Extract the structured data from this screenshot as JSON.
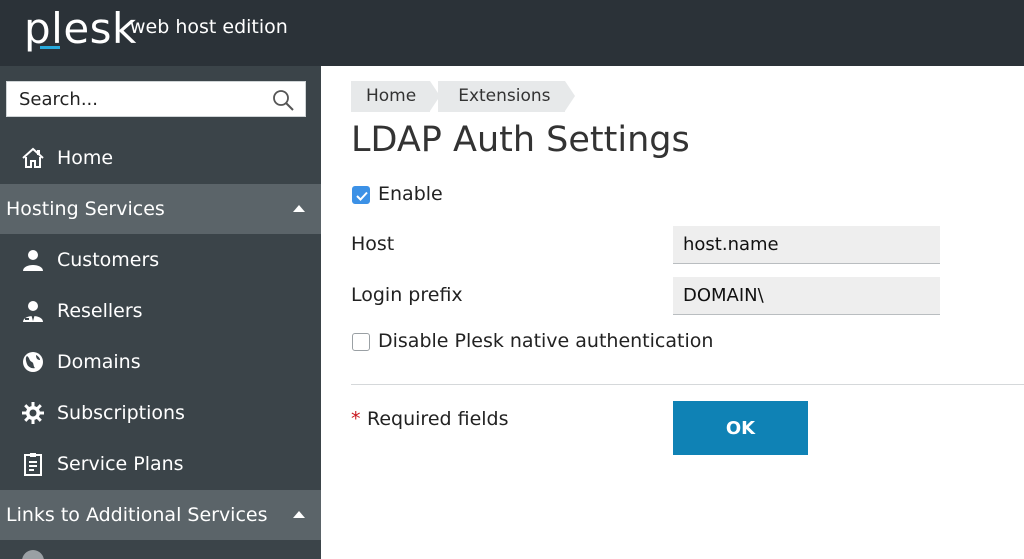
{
  "header": {
    "logo": "plesk",
    "edition": "web host edition"
  },
  "sidebar": {
    "search": {
      "placeholder": "Search..."
    },
    "home_label": "Home",
    "sections": [
      {
        "title": "Hosting Services",
        "items": [
          {
            "label": "Customers",
            "icon": "user-icon"
          },
          {
            "label": "Resellers",
            "icon": "reseller-icon"
          },
          {
            "label": "Domains",
            "icon": "globe-icon"
          },
          {
            "label": "Subscriptions",
            "icon": "gear-icon"
          },
          {
            "label": "Service Plans",
            "icon": "clipboard-icon"
          }
        ]
      },
      {
        "title": "Links to Additional Services",
        "items": []
      }
    ]
  },
  "main": {
    "breadcrumb": [
      "Home",
      "Extensions"
    ],
    "title": "LDAP Auth Settings",
    "enable_label": "Enable",
    "enable_checked": true,
    "host_label": "Host",
    "host_value": "host.name",
    "login_prefix_label": "Login prefix",
    "login_prefix_value": "DOMAIN\\",
    "disable_native_label": "Disable Plesk native authentication",
    "disable_native_checked": false,
    "required_star": "*",
    "required_text": "Required fields",
    "ok_label": "OK"
  },
  "colors": {
    "header_bg": "#2b3238",
    "sidebar_bg": "#3b4449",
    "section_bg": "#5b6469",
    "accent": "#0f82b5",
    "checkbox": "#3c91e6",
    "required": "#c8161d"
  }
}
